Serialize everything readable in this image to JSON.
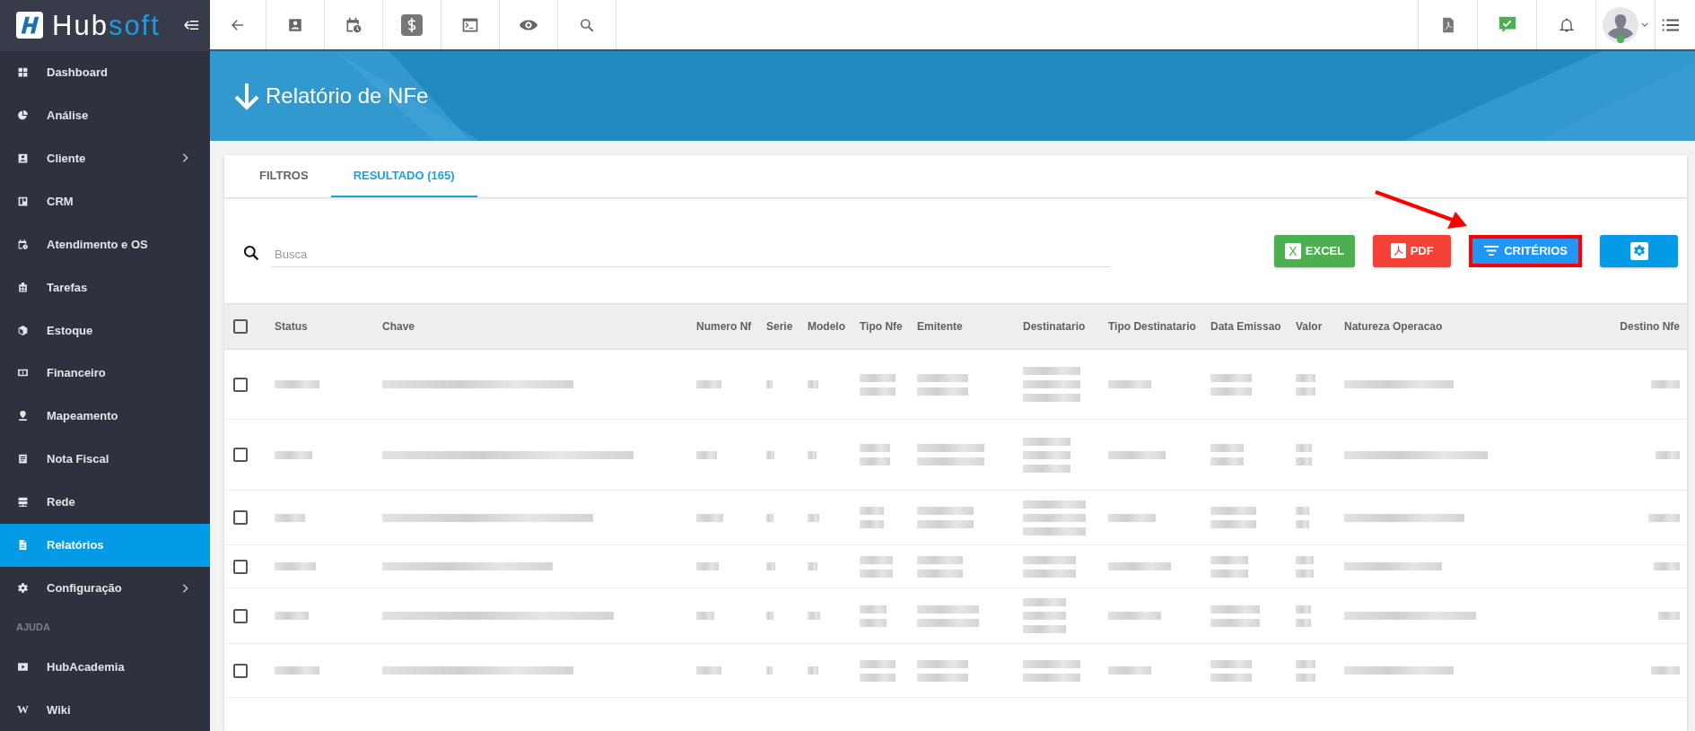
{
  "logo": {
    "main": "Hub",
    "accent": "soft"
  },
  "sidebar": {
    "items": [
      {
        "label": "Dashboard",
        "selected": false,
        "expandable": false
      },
      {
        "label": "Análise",
        "selected": false,
        "expandable": false
      },
      {
        "label": "Cliente",
        "selected": false,
        "expandable": true
      },
      {
        "label": "CRM",
        "selected": false,
        "expandable": false
      },
      {
        "label": "Atendimento e OS",
        "selected": false,
        "expandable": false
      },
      {
        "label": "Tarefas",
        "selected": false,
        "expandable": false
      },
      {
        "label": "Estoque",
        "selected": false,
        "expandable": false
      },
      {
        "label": "Financeiro",
        "selected": false,
        "expandable": false
      },
      {
        "label": "Mapeamento",
        "selected": false,
        "expandable": false
      },
      {
        "label": "Nota Fiscal",
        "selected": false,
        "expandable": false
      },
      {
        "label": "Rede",
        "selected": false,
        "expandable": false
      },
      {
        "label": "Relatórios",
        "selected": true,
        "expandable": false
      },
      {
        "label": "Configuração",
        "selected": false,
        "expandable": true
      }
    ],
    "section": "AJUDA",
    "help_items": [
      {
        "label": "HubAcademia",
        "selected": false
      },
      {
        "label": "Wiki",
        "selected": false,
        "icon_text": "W"
      }
    ]
  },
  "page": {
    "title": "Relatório de NFe"
  },
  "tabs": [
    {
      "label": "FILTROS",
      "selected": false
    },
    {
      "label": "RESULTADO (165)",
      "selected": true
    }
  ],
  "search": {
    "placeholder": "Busca"
  },
  "buttons": [
    {
      "kind": "excel",
      "label": "EXCEL",
      "icon_text": "X",
      "highlighted": false
    },
    {
      "kind": "pdf",
      "label": "PDF",
      "highlighted": false
    },
    {
      "kind": "criteria",
      "label": "CRITÉRIOS",
      "highlighted": true
    },
    {
      "kind": "settings",
      "highlighted": false
    }
  ],
  "table": {
    "select_all_checked": false,
    "columns": [
      "Status",
      "Chave",
      "Numero Nf",
      "Serie",
      "Modelo",
      "Tipo Nfe",
      "Emitente",
      "Destinatario",
      "Tipo Destinatario",
      "Data Emissao",
      "Valor",
      "Natureza Operacao",
      "Destino Nfe"
    ],
    "rows": [
      {
        "checked": false
      },
      {
        "checked": false
      },
      {
        "checked": false
      },
      {
        "checked": false
      },
      {
        "checked": false
      },
      {
        "checked": false
      }
    ]
  }
}
